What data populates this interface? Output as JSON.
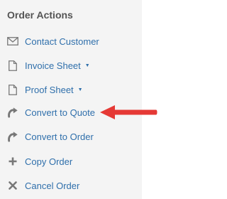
{
  "sidebar": {
    "title": "Order Actions",
    "items": [
      {
        "label": "Contact Customer",
        "icon": "envelope-icon"
      },
      {
        "label": "Invoice Sheet",
        "icon": "document-icon",
        "dropdown": true
      },
      {
        "label": "Proof Sheet",
        "icon": "document-icon",
        "dropdown": true
      },
      {
        "label": "Convert to Quote",
        "icon": "redo-icon"
      },
      {
        "label": "Convert to Order",
        "icon": "redo-icon"
      },
      {
        "label": "Copy Order",
        "icon": "plus-icon"
      },
      {
        "label": "Cancel Order",
        "icon": "x-icon"
      }
    ],
    "caret_glyph": "▼"
  },
  "colors": {
    "link": "#2f6fab",
    "heading": "#555555",
    "panel_bg": "#f4f4f4",
    "icon": "#777777",
    "annotation_arrow": "#e53935"
  }
}
